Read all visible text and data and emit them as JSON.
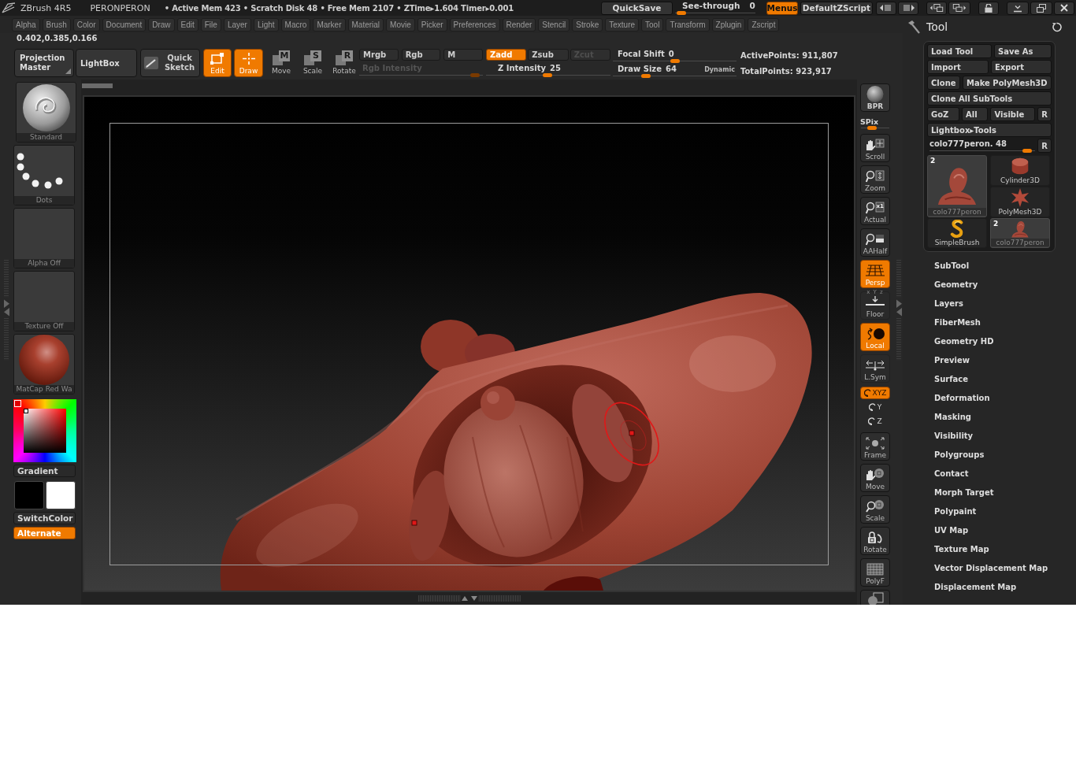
{
  "title_bar": {
    "app_name": "ZBrush 4R5",
    "document": "PERONPERON",
    "stats": "• Active Mem 423 • Scratch Disk 48 • Free Mem 2107 • ZTime▸1.604 Timer▸0.001",
    "quicksave": "QuickSave",
    "see_through": {
      "label": "See-through",
      "value": "0",
      "level": 0.02
    },
    "menus": {
      "label": "Menus",
      "on": true
    },
    "script": "DefaultZScript"
  },
  "menu_bar": [
    "Alpha",
    "Brush",
    "Color",
    "Document",
    "Draw",
    "Edit",
    "File",
    "Layer",
    "Light",
    "Macro",
    "Marker",
    "Material",
    "Movie",
    "Picker",
    "Preferences",
    "Render",
    "Stencil",
    "Stroke",
    "Texture",
    "Tool",
    "Transform",
    "Zplugin",
    "Zscript"
  ],
  "color_value": "0.402,0.385,0.166",
  "top_shelf": {
    "buttons": [
      {
        "kind": "flyout",
        "label": "Projection Master"
      },
      {
        "kind": "plain",
        "label": "LightBox"
      },
      {
        "kind": "sketch",
        "label": "Quick Sketch"
      }
    ],
    "modes": [
      {
        "kind": "edit",
        "label": "Edit",
        "on": true
      },
      {
        "kind": "draw",
        "label": "Draw",
        "on": true
      },
      {
        "kind": "move",
        "label": "Move",
        "glyph": "M",
        "on": false
      },
      {
        "kind": "scale",
        "label": "Scale",
        "glyph": "S",
        "on": false
      },
      {
        "kind": "rotate",
        "label": "Rotate",
        "glyph": "R",
        "on": false
      }
    ],
    "rgb_modes": [
      {
        "label": "Mrgb",
        "selected": false
      },
      {
        "label": "Rgb",
        "selected": false
      },
      {
        "label": "M",
        "selected": false
      }
    ],
    "rgb_intensity": {
      "label": "Rgb Intensity",
      "disabled": true,
      "level": 0.97
    },
    "z_modes": [
      {
        "label": "Zadd",
        "selected": true,
        "disabled": false
      },
      {
        "label": "Zsub",
        "selected": false,
        "disabled": false
      },
      {
        "label": "Zcut",
        "selected": false,
        "disabled": true
      }
    ],
    "z_intensity": {
      "label": "Z Intensity",
      "value": "25",
      "level": 0.49
    },
    "focal_shift": {
      "label": "Focal Shift",
      "value": "0",
      "level": 0.5
    },
    "draw_size": {
      "label": "Draw Size",
      "value": "64",
      "level": 0.25,
      "dynamic": "Dynamic"
    },
    "stats": [
      {
        "label": "ActivePoints:",
        "value": "911,807"
      },
      {
        "label": "TotalPoints:",
        "value": "923,917"
      }
    ]
  },
  "left_shelf": {
    "thumbnails": [
      {
        "kind": "brush",
        "label": "Standard"
      },
      {
        "kind": "stroke",
        "label": "Dots"
      },
      {
        "kind": "alpha",
        "label": "Alpha Off"
      },
      {
        "kind": "texture",
        "label": "Texture Off"
      },
      {
        "kind": "material",
        "label": "MatCap Red Wa"
      }
    ],
    "gradient": "Gradient",
    "swatches": [
      {
        "color": "#000000"
      },
      {
        "color": "#ffffff"
      }
    ],
    "switch_color": "SwitchColor",
    "alternate": {
      "label": "Alternate",
      "on": true
    }
  },
  "right_shelf": {
    "bpr": {
      "label": "BPR"
    },
    "spix": {
      "label": "SPix",
      "level": 0.32
    },
    "buttons": [
      {
        "kind": "scroll",
        "label": "Scroll",
        "on": false
      },
      {
        "kind": "zoom",
        "label": "Zoom",
        "on": false
      },
      {
        "kind": "actual",
        "label": "Actual",
        "glyph": "x1",
        "on": false
      },
      {
        "kind": "aahalf",
        "label": "AAHalf",
        "on": false
      },
      {
        "kind": "persp",
        "label": "Persp",
        "on": true
      },
      {
        "kind": "floor",
        "label": "Floor",
        "glyph": "x Y z",
        "on": false
      },
      {
        "kind": "local",
        "label": "Local",
        "on": true
      },
      {
        "kind": "lsym",
        "label": "L.Sym",
        "on": false
      },
      {
        "kind": "axis",
        "label": "XYZ",
        "on": true
      },
      {
        "kind": "axis",
        "label": "Y",
        "on": false
      },
      {
        "kind": "axis",
        "label": "Z",
        "on": false
      },
      {
        "kind": "frame",
        "label": "Frame",
        "on": false
      },
      {
        "kind": "move",
        "label": "Move",
        "on": false
      },
      {
        "kind": "scale",
        "label": "Scale",
        "on": false
      },
      {
        "kind": "rotate",
        "label": "Rotate",
        "on": false
      },
      {
        "kind": "polyf",
        "label": "PolyF",
        "on": false
      },
      {
        "kind": "sphere_square",
        "on": false
      }
    ]
  },
  "tool_palette": {
    "title": "Tool",
    "button_rows": [
      [
        "Load Tool",
        "Save As"
      ],
      [
        "Import",
        "Export"
      ],
      [
        "Clone",
        "Make PolyMesh3D"
      ],
      [
        "Clone All SubTools"
      ],
      [
        "GoZ",
        "All",
        "Visible",
        "R"
      ],
      [
        "Lightbox▸Tools"
      ]
    ],
    "tool_slider": {
      "label": "colo777peron. 48",
      "level": 0.97,
      "button": "R"
    },
    "tools": [
      {
        "kind": "bust",
        "label": "colo777peron",
        "count": "2",
        "selected": true
      },
      {
        "kind": "cylinder",
        "label": "Cylinder3D",
        "selected": false
      },
      {
        "kind": "star",
        "label": "PolyMesh3D",
        "selected": false
      },
      {
        "kind": "simplebrush",
        "label": "SimpleBrush",
        "selected": false
      },
      {
        "kind": "bust",
        "label": "colo777peron",
        "count": "2",
        "selected": true
      }
    ],
    "subpalettes": [
      "SubTool",
      "Geometry",
      "Layers",
      "FiberMesh",
      "Geometry HD",
      "Preview",
      "Surface",
      "Deformation",
      "Masking",
      "Visibility",
      "Polygroups",
      "Contact",
      "Morph Target",
      "Polypaint",
      "UV Map",
      "Texture Map",
      "Vector Displacement Map",
      "Displacement Map"
    ]
  }
}
